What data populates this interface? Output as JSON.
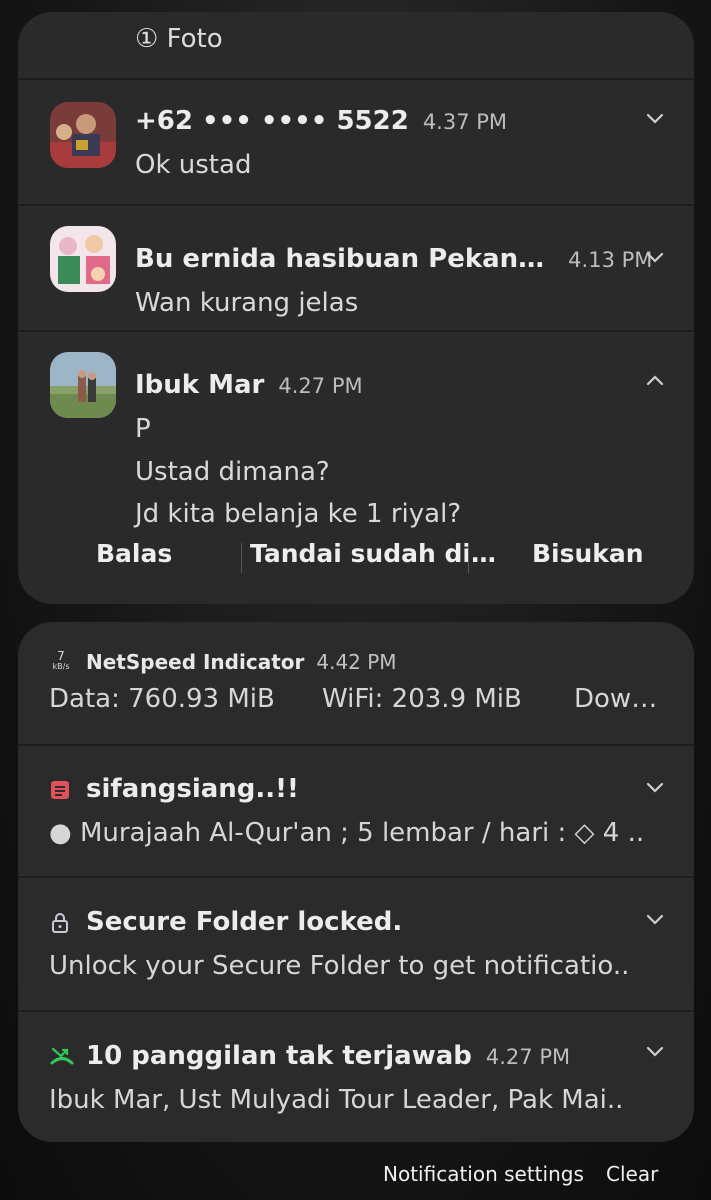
{
  "top_card": {
    "photo_label": "① Foto",
    "notifications": [
      {
        "sender": "+62 ••• •••• 5522",
        "time": "4.37 PM",
        "lines": [
          "Ok ustad"
        ]
      },
      {
        "sender": "Bu ernida hasibuan Pekan…",
        "time": "4.13 PM",
        "lines": [
          "Wan kurang jelas"
        ]
      },
      {
        "sender": "Ibuk Mar",
        "time": "4.27 PM",
        "lines": [
          "P",
          "Ustad dimana?",
          "Jd kita belanja ke 1 riyal?"
        ]
      }
    ],
    "actions": [
      "Balas",
      "Tandai sudah di…",
      "Bisukan"
    ]
  },
  "bottom_card": {
    "netspeed": {
      "icon_text": "7\nkB/s",
      "app": "NetSpeed Indicator",
      "time": "4.42 PM",
      "data": "Data: 760.93 MiB",
      "wifi": "WiFi: 203.9 MiB",
      "down": "Dow…"
    },
    "note": {
      "title": "sifangsiang..!!",
      "body": "● Murajaah Al-Qur'an ; 5 lembar / hari :  ◇ 4 ..",
      "icon_color": "#e0525b"
    },
    "secure": {
      "title": "Secure Folder locked.",
      "body": "Unlock your Secure Folder to get notificatio.."
    },
    "calls": {
      "title": "10 panggilan tak terjawab",
      "time": "4.27 PM",
      "body": "Ibuk Mar, Ust Mulyadi Tour Leader, Pak Mai..",
      "icon_color": "#35c759"
    }
  },
  "footer": {
    "settings_label": "Notification settings",
    "clear_label": "Clear"
  }
}
